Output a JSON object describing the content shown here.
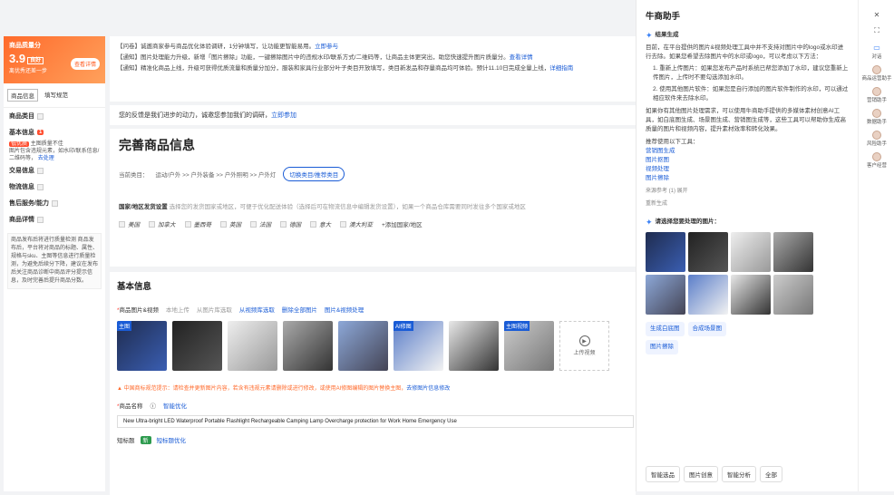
{
  "left_panel": {
    "score_card": {
      "title": "商品质量分",
      "score": "3.9",
      "level": "良好",
      "note": "离优秀还差一步",
      "button": "查看详情"
    },
    "tabs": [
      "商品信息",
      "填写规范"
    ],
    "sections": [
      {
        "label": "商品类目"
      },
      {
        "label": "基本信息",
        "badge": "1"
      },
      {
        "label": "交易信息"
      },
      {
        "label": "物流信息"
      },
      {
        "label": "售后服务/能力"
      },
      {
        "label": "商品详情"
      }
    ],
    "basic_sub": {
      "tag": "低优质",
      "text1": "主图质量不佳",
      "text2": "图片包含违规元素，如水印/联系信息/二维码等，",
      "link": "去处理"
    },
    "tip": "商品发布后将进行质量检测 商品发布后，平台将对商品的标题、属性、规格与sku、主图等信息进行质量检测，为避免后续分下降，建议在发布后关注商品诊断中商品评分提示信息，及时完善后提升商品分数。"
  },
  "notices": [
    {
      "tag": "【问卷】",
      "text": "诚邀商家参与商品优化体验调研，1分钟填写，让功能更智能易用。",
      "link": "立即参与"
    },
    {
      "tag": "【通知】",
      "text": "图片处理能力升级，新增「图片擦除」功能，一键擦除图片中的违规水印/联系方式/二维码等，让商品主体更突出，助您快速提升图片质量分。",
      "link": "查看详情"
    },
    {
      "tag": "【通知】",
      "text": "精准化商品上线，升级可获得优质流量和质量分加分，服装和家具行业部分叶子类目开放填写，类目新发品和存量商品均可体验。预计11.10日完成全量上线，",
      "link": "详细指南"
    }
  ],
  "survey_bar": {
    "text": "您的反馈是我们进步的动力，诚邀您参加我们的调研，",
    "link": "立即参加"
  },
  "main": {
    "title": "完善商品信息",
    "category_label": "当前类目：",
    "category_path": "运动/户外 >> 户外装备 >> 户外照明 >> 户外灯",
    "category_button": "切换类目/推荐类目",
    "region_label": "国家/地区发货设置",
    "region_hint": "选择您的发货国家或地区，可便于优化配送体验（选择后可在物流信息中编辑发货设置），如果一个商品仓库需要同时发往多个国家或地区",
    "countries": [
      "美国",
      "加拿大",
      "墨西哥",
      "英国",
      "法国",
      "德国",
      "意大",
      "澳大利亚"
    ],
    "add_region": "+添加国家/地区"
  },
  "basic_info": {
    "title": "基本信息",
    "images_label": "商品图片&视频",
    "upload_local": "本地上传",
    "from_library": "从图片库选取",
    "from_video": "从视频库选取",
    "delete_all": "删除全部图片",
    "image_tools": "图片&视频处理",
    "thumbs": [
      {
        "tag": "主图"
      },
      {
        "tag": ""
      },
      {
        "tag": ""
      },
      {
        "tag": ""
      },
      {
        "tag": ""
      },
      {
        "tag": "AI修图"
      },
      {
        "tag": ""
      },
      {
        "tag": "主图视频"
      }
    ],
    "upload_video": "上传视频",
    "warning": "中国商标规范提示：请检查并更新图片内容，若含有违规元素请删除或进行修改，或使用AI修图编辑的图片替换主图，",
    "warning_link": "去修图片信息修改",
    "name_label": "商品名称",
    "smart_optimize": "智能优化",
    "name_value": "New Ultra-bright LED Waterproof Portable Flashlight Rechargeable Camping Lamp Overcharge protection for Work Home Emergency Use",
    "short_title_label": "短标题",
    "short_title_badge": "新",
    "short_title_link": "短标题优化"
  },
  "assistant": {
    "title": "牛商助手",
    "section1": "结果生成",
    "intro": "目前，在平台提供的图片&视频处理工具中并不支持对图片中的logo或水印进行去除。如果您希望去除图片中的水印或logo，可以考虑以下方法：",
    "step1": "1. 重新上传图片：如果您发布产品时系统已帮您添加了水印，建议您重新上传图片，上传时不要勾选添加水印。",
    "step2": "2. 使用其他图片软件：如果您是自行添加的图片软件制作的水印，可以通过相应软件来去除水印。",
    "extra": "如果你有其他图片处理需求，可以使用牛商助手提供的多媒体素材创意AI工具，如白底图生成、场景图生成、营销图生成等，这些工具可以帮助你生成高质量的图片和视频内容，提升素材效率和转化效果。",
    "tools_label": "推荐使用以下工具：",
    "tools": [
      "营销图生成",
      "图片抠图",
      "视频处理",
      "图片擦除"
    ],
    "ref": "来源参考 (1) 展开",
    "regen": "重新生成",
    "choose_label": "请选择您要处理的图片：",
    "actions": [
      "生成白底图",
      "合成场景图",
      "图片擦除"
    ],
    "bottom_tabs": [
      "智能选品",
      "图片创意",
      "智能分析",
      "全部"
    ]
  },
  "rail": {
    "items": [
      "对话",
      "商品运营助手",
      "营销助手",
      "数据助手",
      "风险助手",
      "客户经营"
    ]
  }
}
